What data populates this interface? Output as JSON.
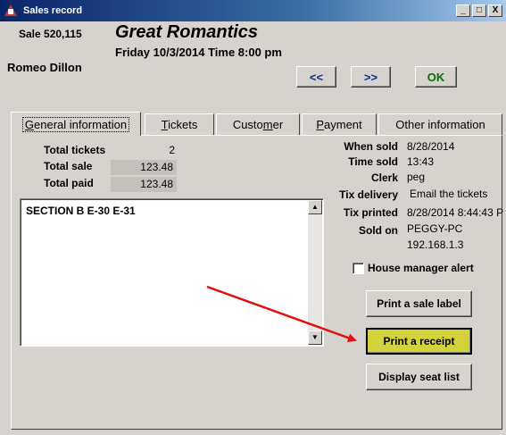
{
  "window": {
    "title": "Sales record",
    "controls": [
      "_",
      "□",
      "X"
    ]
  },
  "sale": {
    "number": "Sale 520,115",
    "customer": "Romeo Dillon"
  },
  "event": {
    "title": "Great Romantics",
    "date": "Friday 10/3/2014  Time 8:00 pm"
  },
  "nav": {
    "prev": "<<",
    "next": ">>",
    "ok": "OK"
  },
  "tabs": [
    {
      "pre": "",
      "u": "G",
      "post": "eneral information"
    },
    {
      "pre": "",
      "u": "T",
      "post": "ickets"
    },
    {
      "pre": "Custo",
      "u": "m",
      "post": "er"
    },
    {
      "pre": "",
      "u": "P",
      "post": "ayment"
    },
    {
      "pre": "Other information",
      "u": "",
      "post": ""
    }
  ],
  "totals": {
    "tickets_label": "Total tickets",
    "tickets": "2",
    "sale_label": "Total sale",
    "sale": "123.48",
    "paid_label": "Total paid",
    "paid": "123.48"
  },
  "notes": "SECTION B E-30 E-31",
  "info": {
    "when_sold_label": "When sold",
    "when_sold": "8/28/2014",
    "time_sold_label": "Time sold",
    "time_sold": "13:43",
    "clerk_label": "Clerk",
    "clerk": "peg",
    "tix_delivery_label": "Tix delivery",
    "tix_delivery": "Email the tickets",
    "tix_printed_label": "Tix printed",
    "tix_printed": "8/28/2014 8:44:43 P",
    "sold_on_label": "Sold on",
    "sold_on_host": "PEGGY-PC",
    "sold_on_ip": "192.168.1.3"
  },
  "house_manager_alert": {
    "label": "House manager alert",
    "checked": false
  },
  "actions": {
    "print_sale_label": "Print a sale label",
    "print_receipt": "Print a receipt",
    "display_seat_list": "Display seat list"
  },
  "colors": {
    "annotation_arrow": "#e01010",
    "highlight_button": "#d2d23c"
  }
}
